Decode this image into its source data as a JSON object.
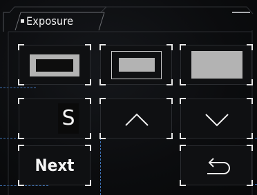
{
  "panel": {
    "title": "Exposure"
  },
  "buttons": {
    "metering_spot": "metering-spot",
    "metering_center": "metering-center",
    "metering_full": "metering-full",
    "shutter_priority": "S",
    "increase": "up",
    "decrease": "down",
    "next": "Next",
    "back": "back"
  },
  "colors": {
    "accent_guide": "#3f74b8",
    "frame": "#3a3c40",
    "corner": "#e6e6e6"
  }
}
